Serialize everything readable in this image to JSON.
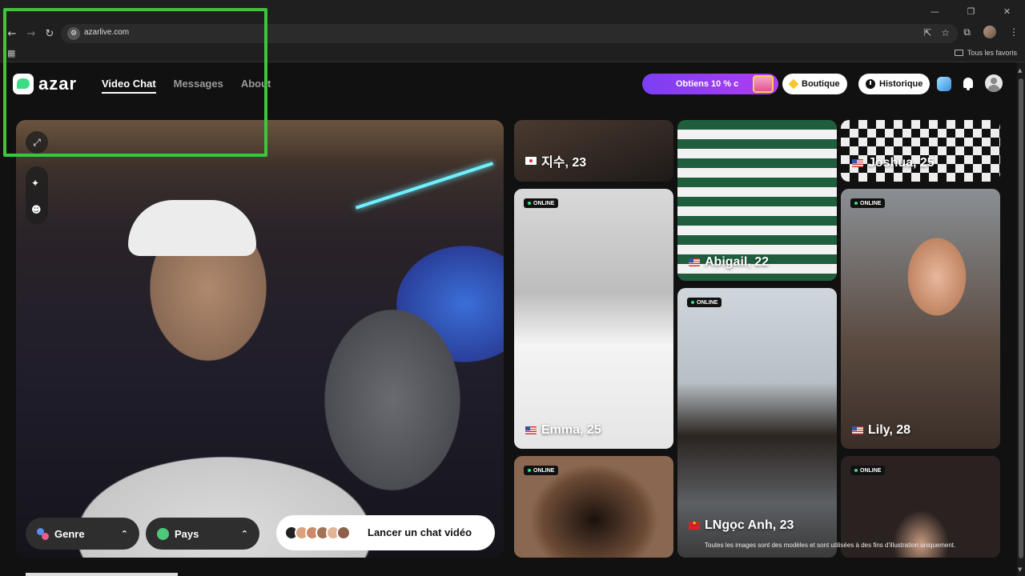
{
  "browser": {
    "url": "azarlive.com",
    "bookmark_all": "Tous les favoris",
    "win_controls": [
      "—",
      "❐",
      "✕"
    ]
  },
  "header": {
    "logo_text": "azar",
    "nav": [
      {
        "label": "Video Chat",
        "active": true
      },
      {
        "label": "Messages",
        "active": false
      },
      {
        "label": "About",
        "active": false
      }
    ],
    "promo_label": "Obtiens 10 % c",
    "boutique_label": "Boutique",
    "historique_label": "Historique"
  },
  "cam": {
    "genre_label": "Genre",
    "pays_label": "Pays",
    "launch_label": "Lancer un chat vidéo"
  },
  "profiles": [
    {
      "name": "지수, 23",
      "flag": "kr",
      "online": false
    },
    {
      "name": "Abigail, 22",
      "flag": "us",
      "online": false
    },
    {
      "name": "Joshua, 25",
      "flag": "us",
      "online": false
    },
    {
      "name": "Emma, 25",
      "flag": "us",
      "online": true
    },
    {
      "name": "Lily, 28",
      "flag": "us",
      "online": true
    },
    {
      "name": "LNgọc Anh, 23",
      "flag": "vn",
      "online": true
    },
    {
      "online": true
    },
    {
      "online": true
    }
  ],
  "online_badge": "ONLINE",
  "disclaimer": "Toutes les images sont des modèles et sont utilisées à des fins d'illustration uniquement.",
  "colors": {
    "background": "#111111",
    "promo_start": "#7b3ff2",
    "promo_end": "#b13cf0",
    "online_dot": "#3ddc84",
    "overlay_border": "#3fc43b"
  }
}
